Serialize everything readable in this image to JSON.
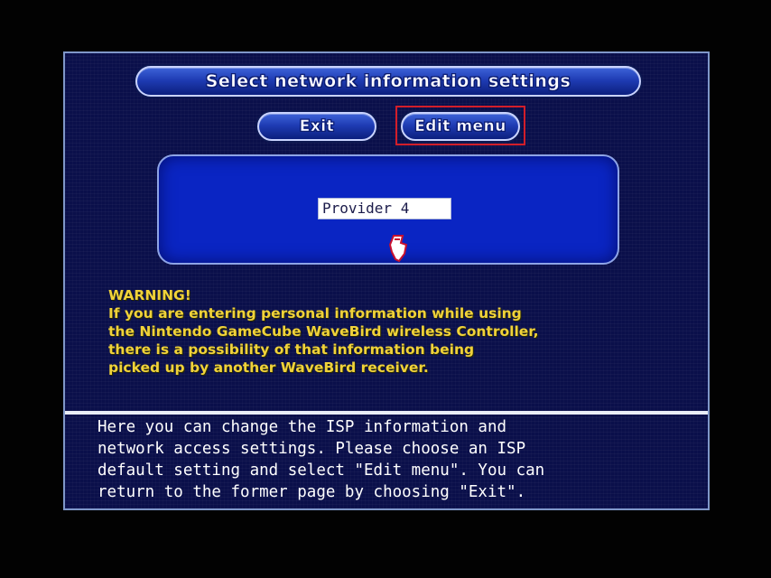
{
  "screen": {
    "title": "Select network information settings",
    "colors": {
      "window_bg": "#0a0f4a",
      "panel_blue": "#0a25c3",
      "warning_yellow": "#f0d23a",
      "highlight_red": "#d21e2a"
    }
  },
  "buttons": {
    "exit_label": "Exit",
    "edit_menu_label": "Edit menu"
  },
  "provider": {
    "selected_value": "Provider 4",
    "icon": "pointer-hand-icon"
  },
  "warning": {
    "heading": "WARNING!",
    "lines": [
      "If you are entering personal information while using",
      "the Nintendo GameCube WaveBird wireless Controller,",
      "there is a possibility of that information being",
      "picked up by another WaveBird receiver."
    ]
  },
  "help": {
    "lines": [
      "Here you can change the ISP information and",
      "network access settings. Please choose an ISP",
      "default setting and select \"Edit menu\".  You can",
      "return to the former page by choosing \"Exit\"."
    ]
  }
}
